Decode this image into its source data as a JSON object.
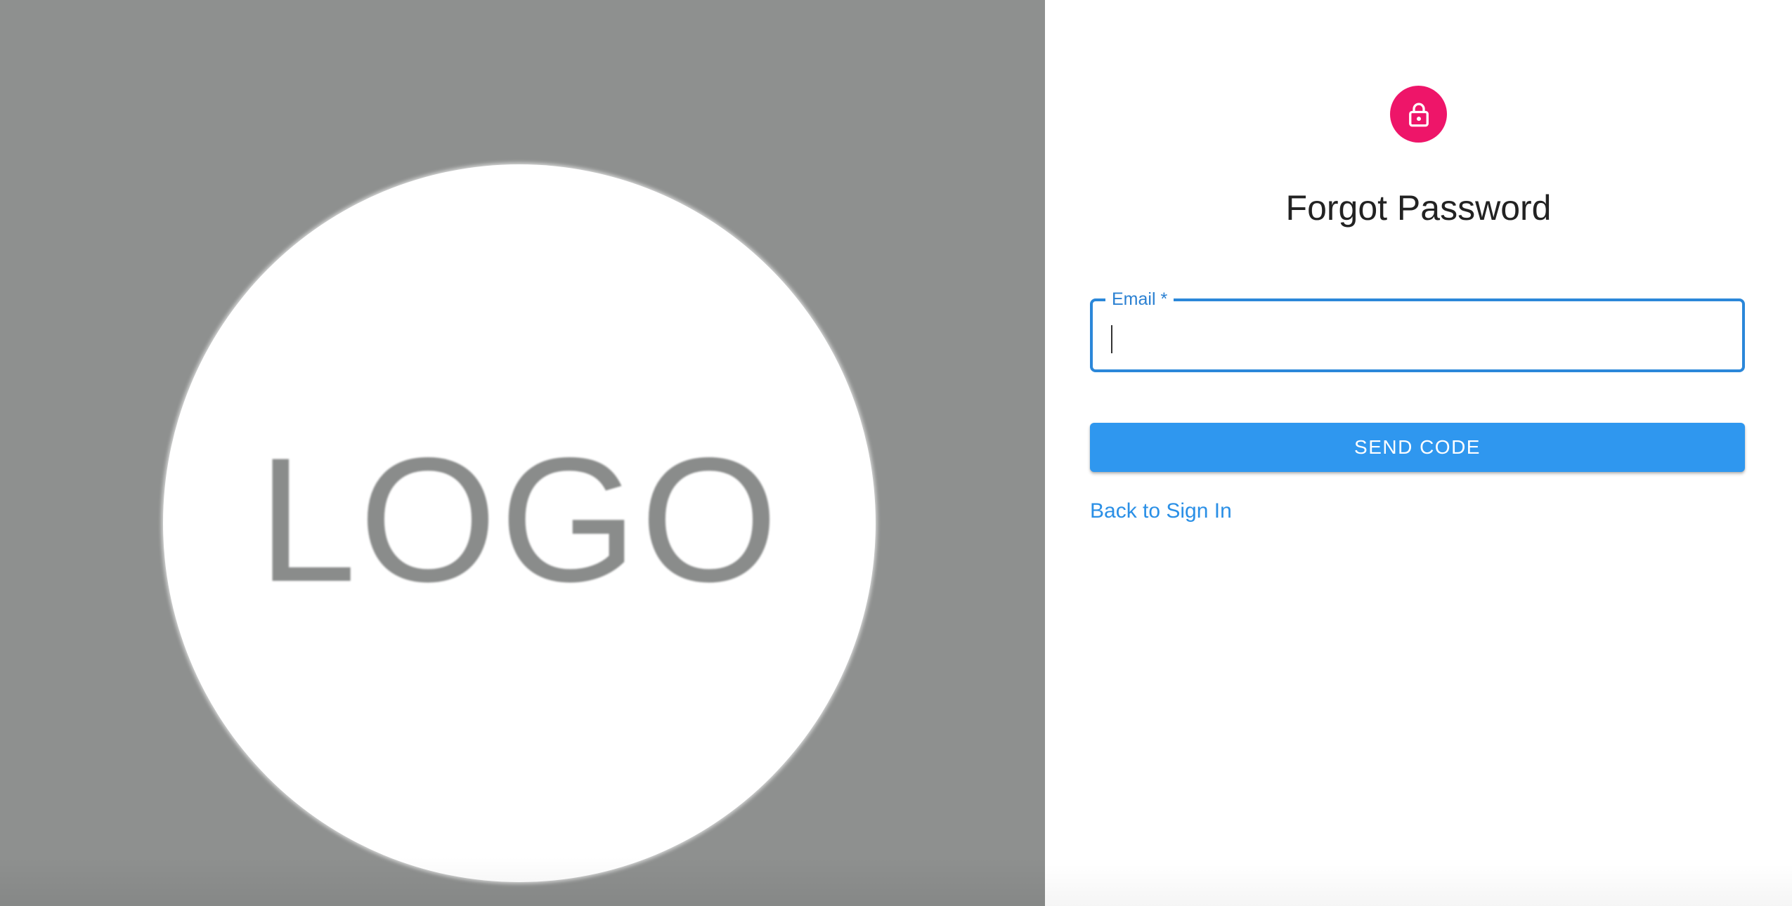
{
  "hero": {
    "logo_text": "LOGO"
  },
  "form": {
    "title": "Forgot Password",
    "email_label": "Email *",
    "email_value": "",
    "send_button_label": "SEND CODE",
    "back_link_label": "Back to Sign In"
  },
  "icons": {
    "avatar": "lock-icon"
  },
  "colors": {
    "hero_background": "#8e908f",
    "avatar_background": "#ee1569",
    "primary": "#2f97ef",
    "field_border": "#2b87d9",
    "link": "#2a8fe6"
  }
}
